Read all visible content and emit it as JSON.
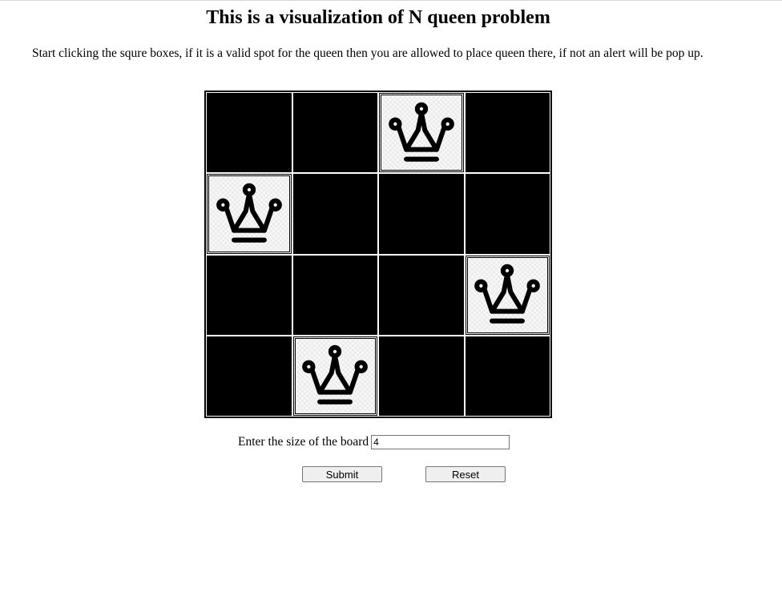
{
  "header": {
    "title": "This is a visualization of N queen problem"
  },
  "instructions": "Start clicking the squre boxes, if it is a valid spot for the queen then you are allowed to place queen there, if not an alert will be pop up.",
  "board": {
    "size": 4,
    "queen_icon": "crown-icon",
    "cells": [
      [
        false,
        false,
        true,
        false
      ],
      [
        true,
        false,
        false,
        false
      ],
      [
        false,
        false,
        false,
        true
      ],
      [
        false,
        true,
        false,
        false
      ]
    ]
  },
  "form": {
    "size_label": "Enter the size of the board",
    "size_value": "4",
    "submit_label": "Submit",
    "reset_label": "Reset"
  }
}
